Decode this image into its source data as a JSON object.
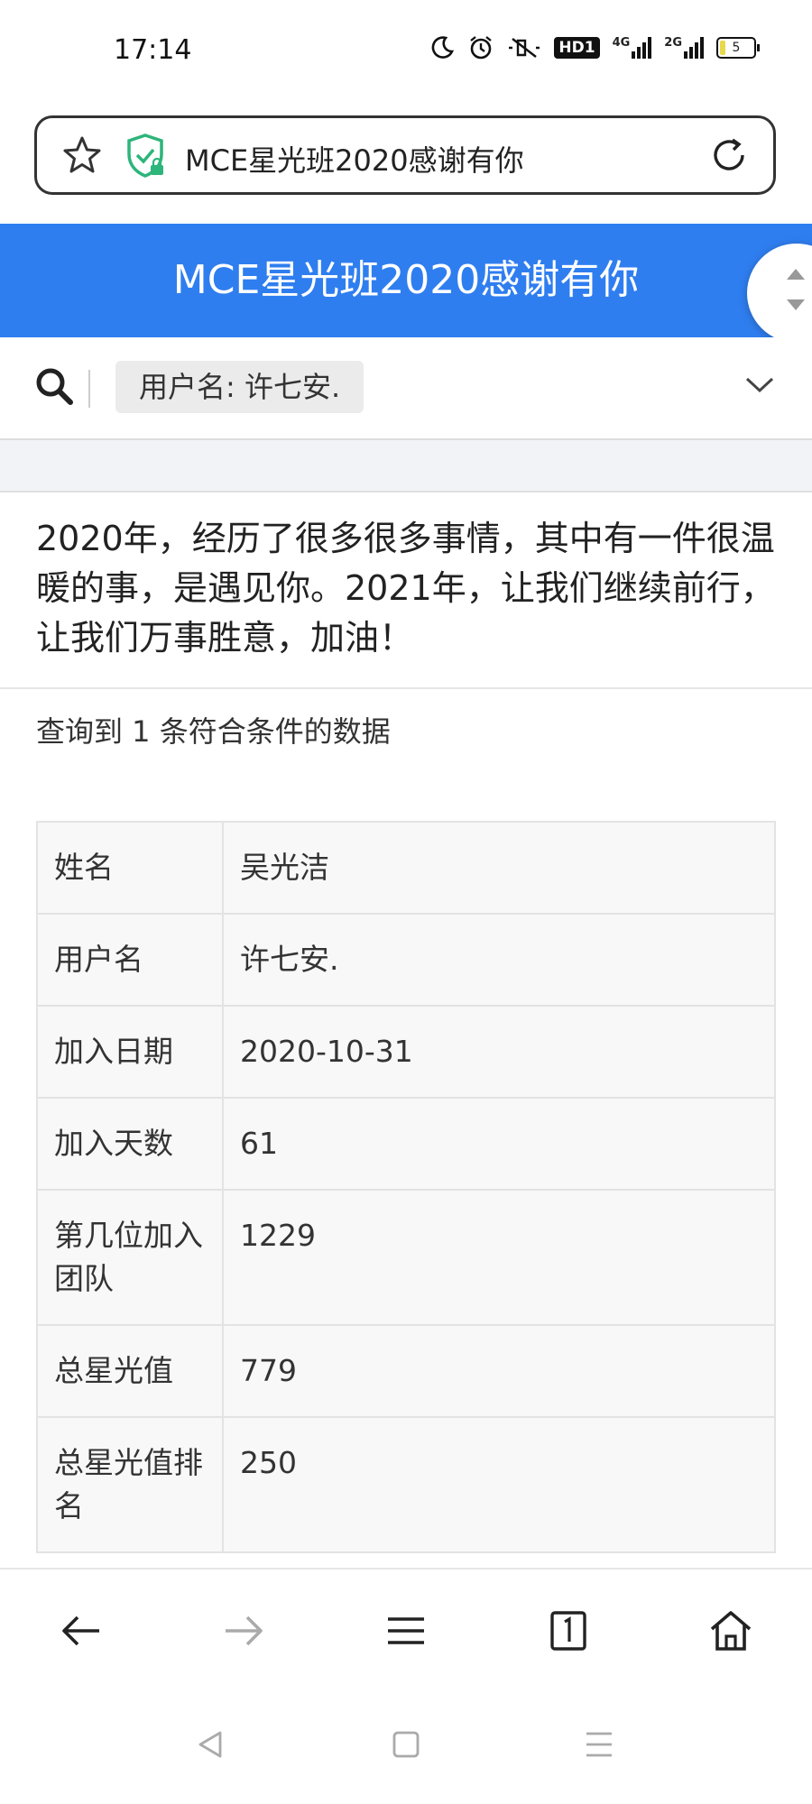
{
  "status_bar": {
    "time": "17:14",
    "hd_badge": "HD1",
    "signal1_label": "4G",
    "signal2_label": "2G",
    "battery_level": "5",
    "icons": [
      "moon-icon",
      "alarm-icon",
      "mute-icon",
      "hd-icon",
      "signal-4g-icon",
      "signal-2g-icon",
      "battery-icon"
    ]
  },
  "address_bar": {
    "url_text": "MCE星光班2020感谢有你",
    "icons": [
      "star-icon",
      "shield-lock-icon",
      "reload-icon"
    ]
  },
  "header": {
    "title": "MCE星光班2020感谢有你"
  },
  "search": {
    "chip_label": "用户名: 许七安."
  },
  "content": {
    "intro": "2020年，经历了很多很多事情，其中有一件很温暖的事，是遇见你。2021年，让我们继续前行，让我们万事胜意，加油！",
    "result_count": "查询到 1 条符合条件的数据",
    "rows": [
      {
        "key": "姓名",
        "value": "吴光洁"
      },
      {
        "key": "用户名",
        "value": "许七安."
      },
      {
        "key": "加入日期",
        "value": "2020-10-31"
      },
      {
        "key": "加入天数",
        "value": "61"
      },
      {
        "key": "第几位加入团队",
        "value": "1229"
      },
      {
        "key": "总星光值",
        "value": "779"
      },
      {
        "key": "总星光值排名",
        "value": "250"
      }
    ]
  },
  "colors": {
    "header_bg": "#2f7ef0",
    "gap_bg": "#f2f3f7",
    "shield_green": "#2db57a"
  }
}
